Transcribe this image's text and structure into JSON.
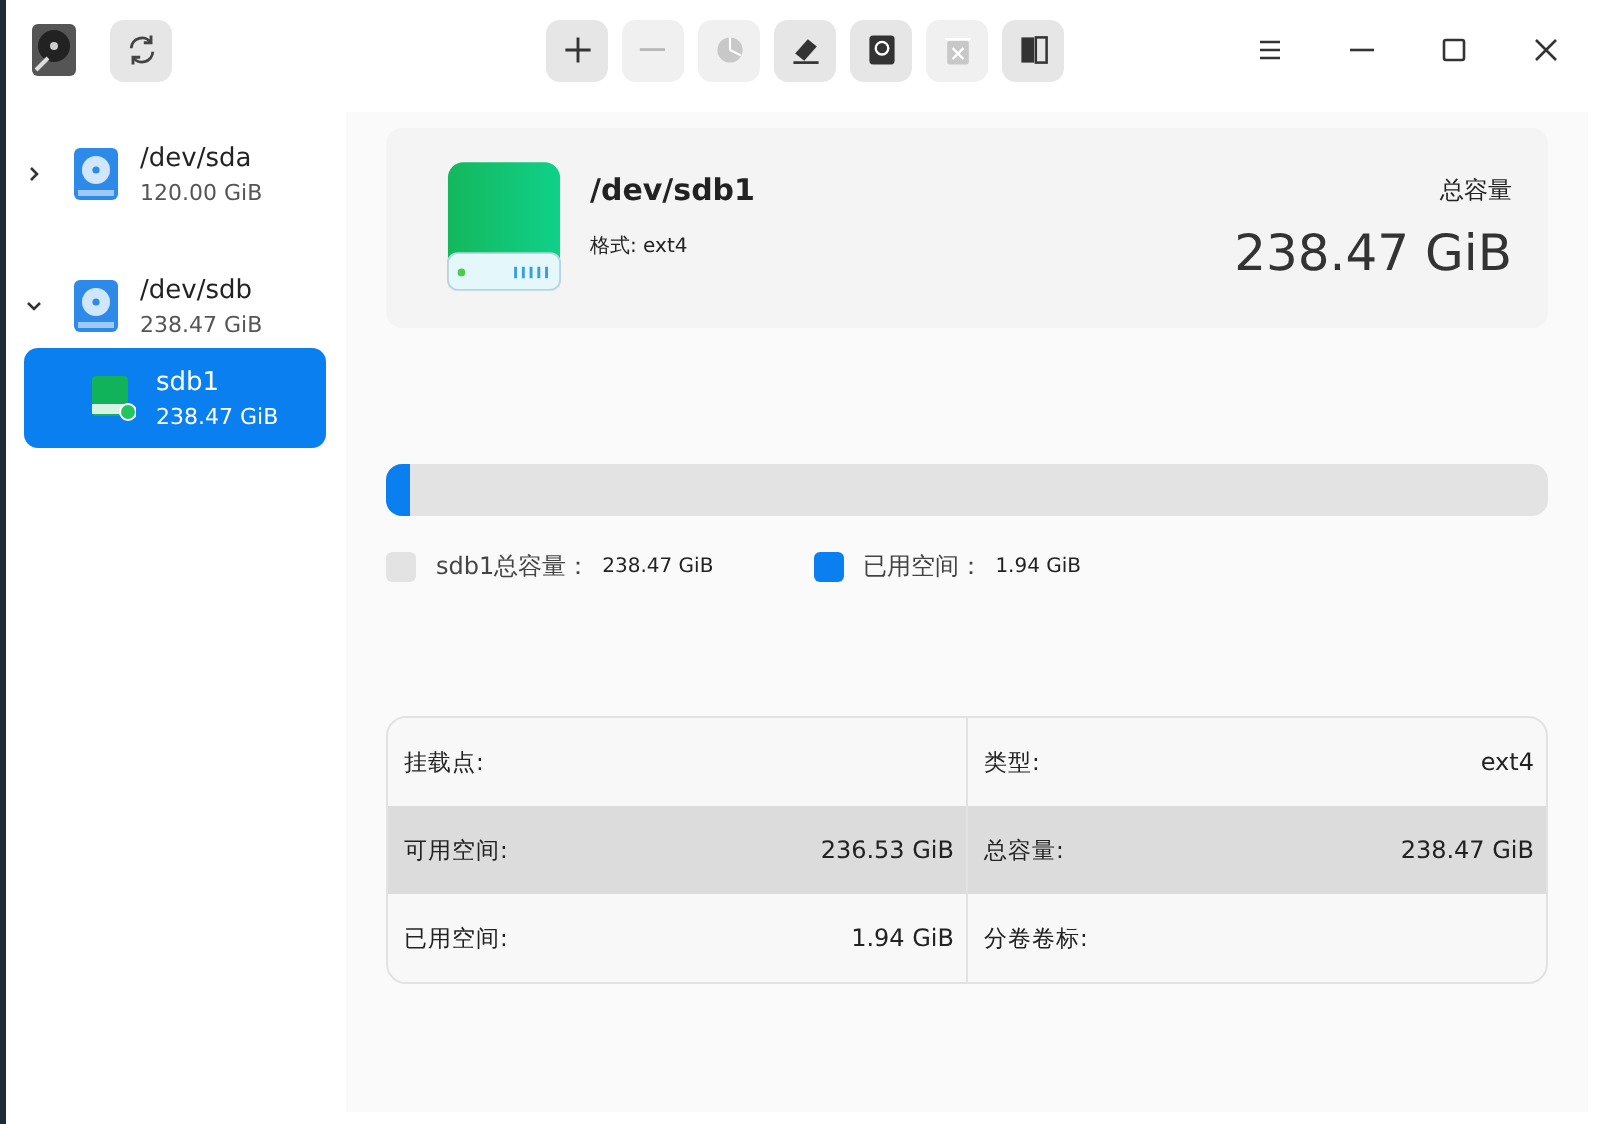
{
  "toolbar": {
    "tools": [
      {
        "kind": "add",
        "disabled": false
      },
      {
        "kind": "remove",
        "disabled": true
      },
      {
        "kind": "partition",
        "disabled": true
      },
      {
        "kind": "erase",
        "disabled": false
      },
      {
        "kind": "backup",
        "disabled": false
      },
      {
        "kind": "delete",
        "disabled": true
      },
      {
        "kind": "split",
        "disabled": false
      }
    ]
  },
  "sidebar": {
    "devices": [
      {
        "name": "/dev/sda",
        "size": "120.00 GiB",
        "expanded": false
      },
      {
        "name": "/dev/sdb",
        "size": "238.47 GiB",
        "expanded": true,
        "children": [
          {
            "name": "sdb1",
            "size": "238.47 GiB",
            "selected": true
          }
        ]
      }
    ]
  },
  "header": {
    "name": "/dev/sdb1",
    "format": "格式: ext4",
    "total_label": "总容量",
    "total": "238.47 GiB"
  },
  "usage": {
    "level": 0.02,
    "legend": [
      {
        "label": "sdb1总容量：",
        "value": "238.47 GiB",
        "color": "#e3e3e3"
      },
      {
        "label": "已用空间：",
        "value": "1.94 GiB",
        "color": "#0a7ff0"
      }
    ]
  },
  "details": [
    [
      {
        "label": "挂载点:"
      },
      {
        "label": "类型:",
        "value": "ext4"
      }
    ],
    [
      {
        "label": "可用空间:",
        "value": "236.53 GiB"
      },
      {
        "label": "总容量:",
        "value": "238.47 GiB"
      }
    ],
    [
      {
        "label": "已用空间:",
        "value": "1.94 GiB"
      },
      {
        "label": "分卷卷标:"
      }
    ]
  ]
}
